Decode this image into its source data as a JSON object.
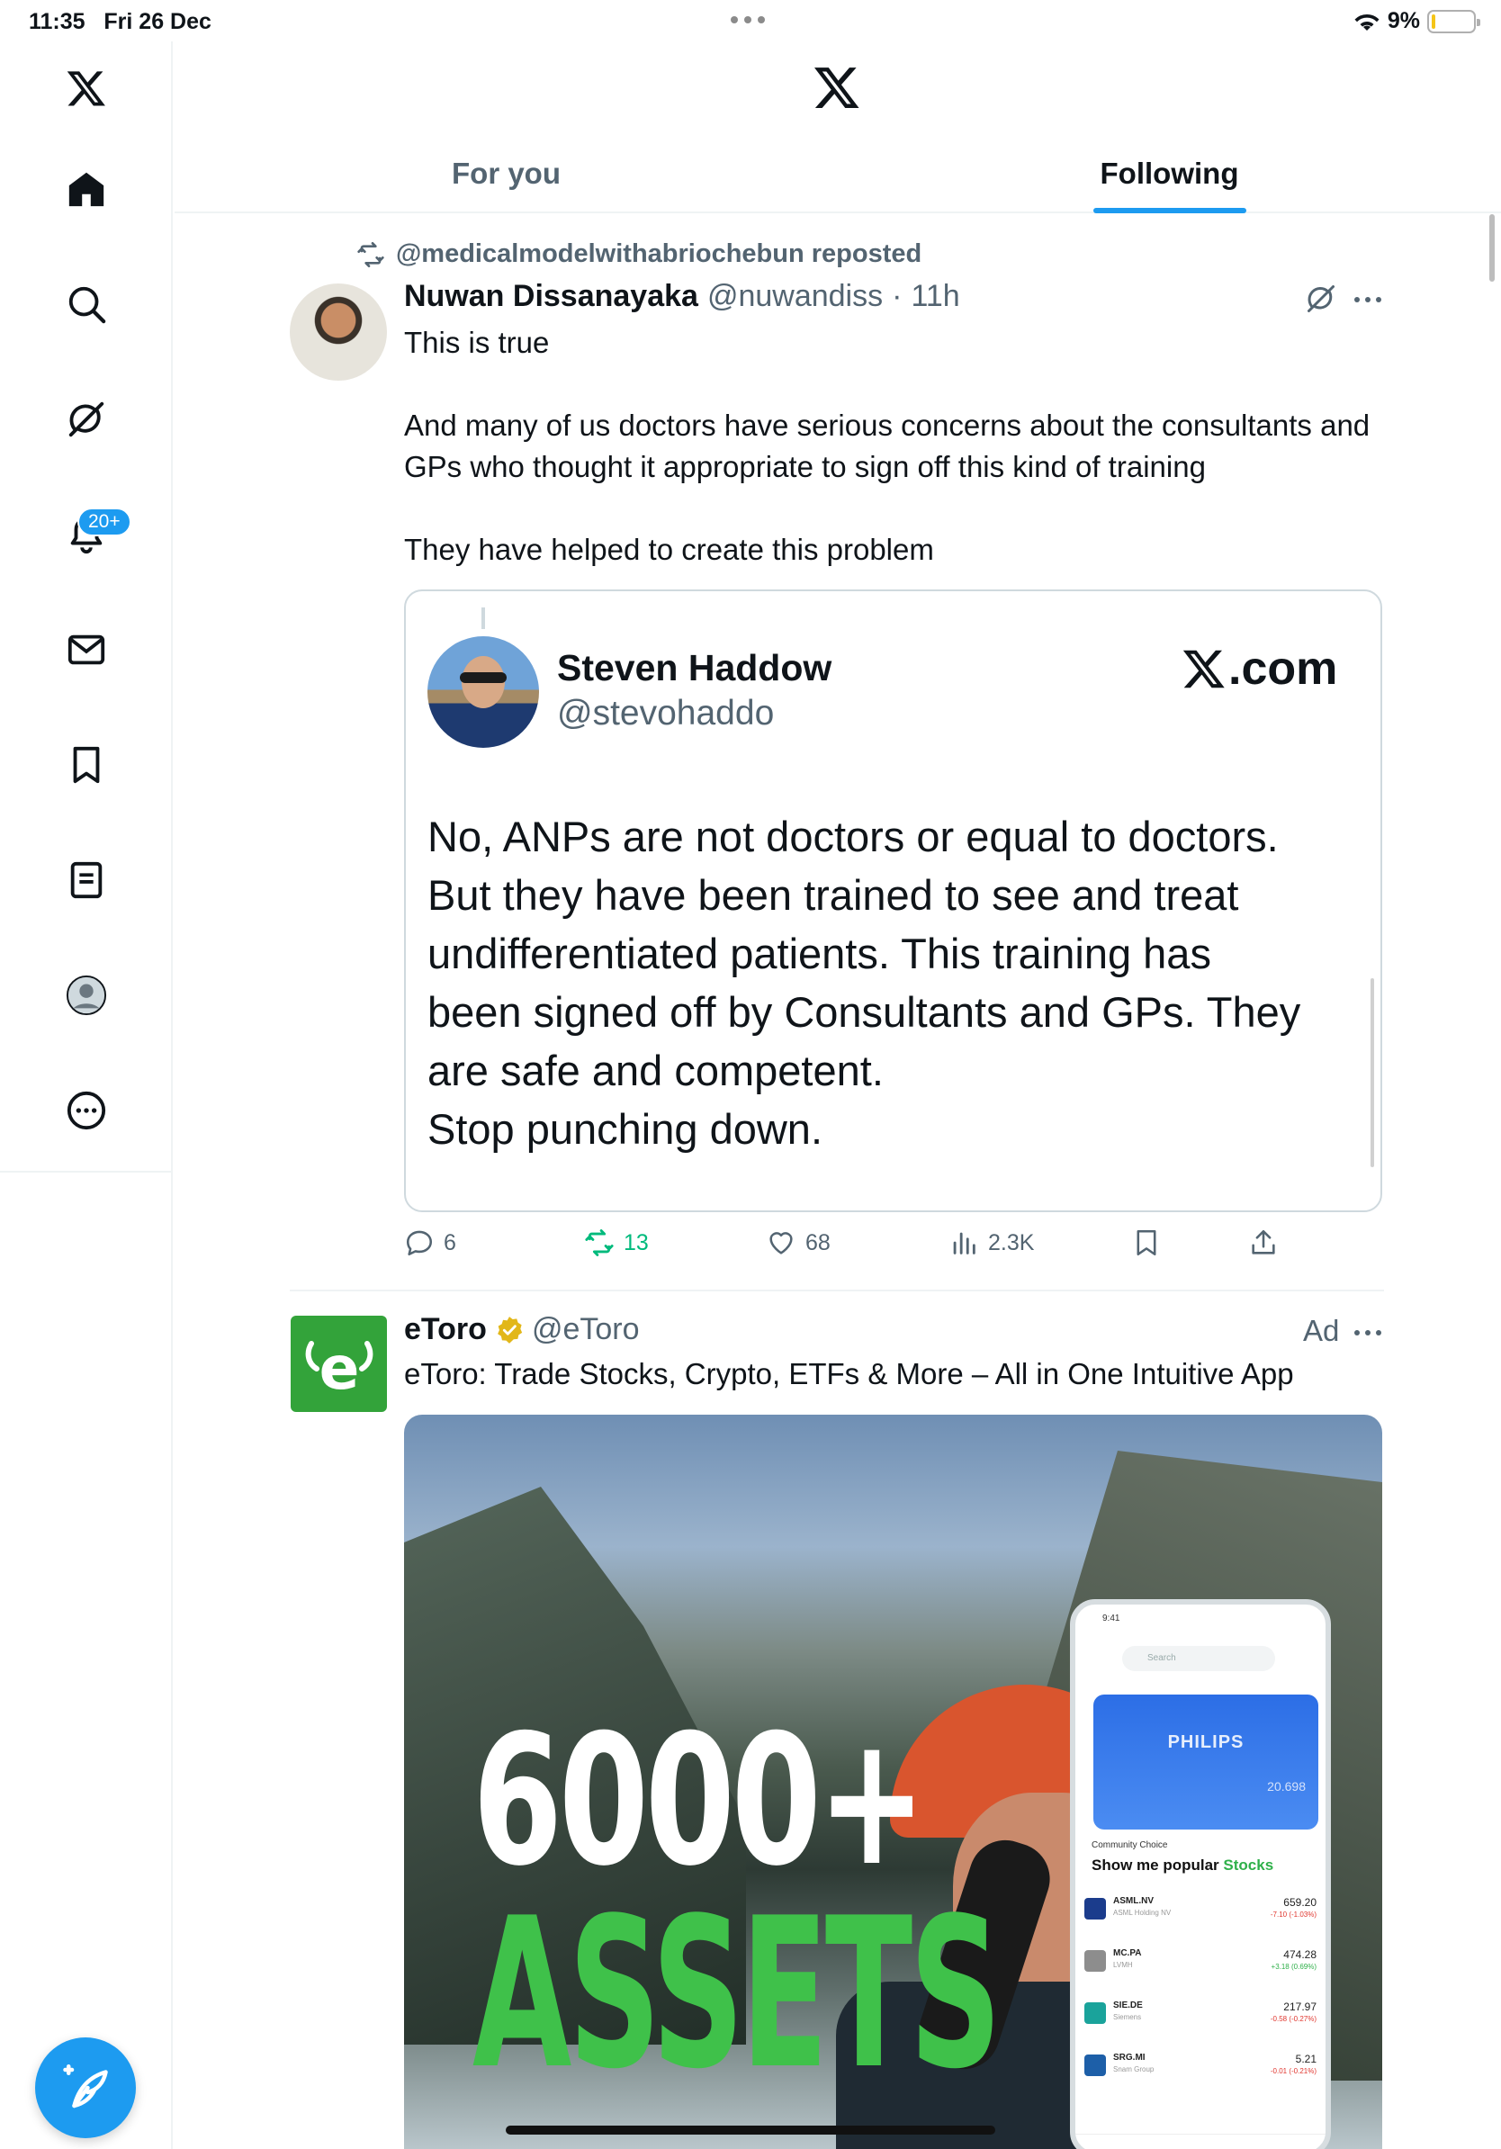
{
  "status_bar": {
    "time": "11:35",
    "date": "Fri 26 Dec",
    "battery_percent": "9%",
    "battery_level": 0.09
  },
  "sidebar": {
    "items": [
      {
        "name": "x-logo",
        "icon": "x-logo-icon"
      },
      {
        "name": "home",
        "icon": "home-icon"
      },
      {
        "name": "explore",
        "icon": "search-icon"
      },
      {
        "name": "grok",
        "icon": "grok-icon"
      },
      {
        "name": "notifications",
        "icon": "bell-icon"
      },
      {
        "name": "messages",
        "icon": "mail-icon"
      },
      {
        "name": "bookmarks",
        "icon": "bookmark-icon"
      },
      {
        "name": "lists",
        "icon": "list-icon"
      },
      {
        "name": "profile",
        "icon": "avatar-icon"
      },
      {
        "name": "more",
        "icon": "more-circle-icon"
      }
    ],
    "notification_badge": "20+",
    "compose_icon": "feather-plus-icon"
  },
  "header": {
    "logo": "x-logo-icon",
    "tabs": [
      {
        "label": "For you",
        "active": false
      },
      {
        "label": "Following",
        "active": true
      }
    ]
  },
  "post": {
    "reposted_by": "@medicalmodelwithabriochebun reposted",
    "author_name": "Nuwan Dissanayaka",
    "author_handle": "@nuwandiss",
    "dot": "·",
    "time": "11h",
    "paragraphs": [
      "This is true",
      "And many of us doctors have serious concerns about the consultants and GPs who thought it appropriate to sign off this kind of training",
      "They have helped to create this problem"
    ],
    "embedded": {
      "name": "Steven Haddow",
      "handle": "@stevohaddo",
      "brand": ".com",
      "lines": [
        "No, ANPs are not doctors or equal to doctors.",
        "But they have been trained to see and treat",
        "undifferentiated patients.  This training has",
        "been signed off by Consultants and GPs. They",
        "are safe and competent.",
        "Stop punching down."
      ]
    },
    "actions": {
      "replies": "6",
      "reposts": "13",
      "likes": "68",
      "views": "2.3K"
    }
  },
  "ad": {
    "name": "eToro",
    "handle": "@eToro",
    "label": "Ad",
    "logo_letter": "e",
    "text": "eToro: Trade Stocks, Crypto, ETFs & More – All in One Intuitive App",
    "media": {
      "headline_top": "6000+",
      "headline_bottom": "ASSETS",
      "phone": {
        "time": "9:41",
        "search": "Search",
        "card_title": "PHILIPS",
        "card_value": "20.698",
        "section": "Community Choice",
        "heading_prefix": "Show me popular ",
        "heading_accent": "Stocks",
        "rows": [
          {
            "symbol": "ASML.NV",
            "name": "ASML Holding NV",
            "price": "659.20",
            "change": "-7.10 (-1.03%)",
            "color": "#1b3c8c",
            "change_color": "#e0362e"
          },
          {
            "symbol": "MC.PA",
            "name": "LVMH",
            "price": "474.28",
            "change": "+3.18 (0.69%)",
            "color": "#8d8d8d",
            "change_color": "#2fb04a"
          },
          {
            "symbol": "SIE.DE",
            "name": "Siemens",
            "price": "217.97",
            "change": "-0.58 (-0.27%)",
            "color": "#1aa39b",
            "change_color": "#e0362e"
          },
          {
            "symbol": "SRG.MI",
            "name": "Snam Group",
            "price": "5.21",
            "change": "-0.01 (-0.21%)",
            "color": "#1d5fa8",
            "change_color": "#e0362e"
          }
        ]
      }
    }
  },
  "colors": {
    "accent": "#1d9bf0",
    "repost_green": "#00ba7c",
    "etoro_green": "#33a33a",
    "text_secondary": "#536471"
  }
}
